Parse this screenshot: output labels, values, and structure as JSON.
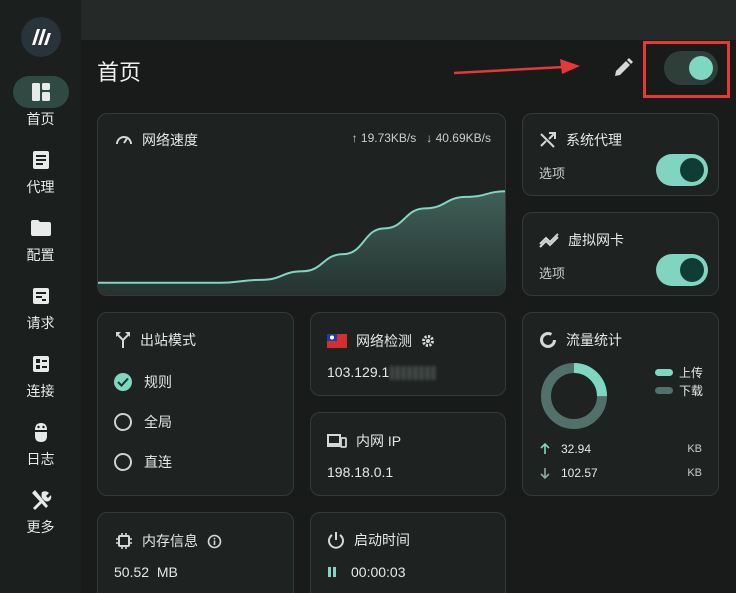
{
  "sidebar": {
    "items": [
      {
        "label": "首页",
        "icon": "dashboard-icon",
        "active": true
      },
      {
        "label": "代理",
        "icon": "document-icon"
      },
      {
        "label": "配置",
        "icon": "folder-icon"
      },
      {
        "label": "请求",
        "icon": "request-icon"
      },
      {
        "label": "连接",
        "icon": "connection-icon"
      },
      {
        "label": "日志",
        "icon": "bug-icon"
      },
      {
        "label": "更多",
        "icon": "tools-icon"
      }
    ]
  },
  "header": {
    "title": "首页"
  },
  "network_speed": {
    "title": "网络速度",
    "upload": "↑ 19.73KB/s",
    "download": "↓ 40.69KB/s",
    "chart_data": {
      "type": "area",
      "x": [
        0,
        1,
        2,
        3,
        4,
        5,
        6,
        7,
        8,
        9,
        10
      ],
      "values": [
        0.1,
        0.1,
        0.1,
        0.1,
        0.12,
        0.18,
        0.3,
        0.48,
        0.62,
        0.7,
        0.74
      ],
      "ylim": [
        0,
        1
      ],
      "grid": false
    }
  },
  "system_proxy": {
    "title": "系统代理",
    "option_label": "选项",
    "enabled": true
  },
  "virtual_nic": {
    "title": "虚拟网卡",
    "option_label": "选项",
    "enabled": true
  },
  "outbound_mode": {
    "title": "出站模式",
    "options": [
      {
        "label": "规则",
        "checked": true
      },
      {
        "label": "全局",
        "checked": false
      },
      {
        "label": "直连",
        "checked": false
      }
    ]
  },
  "network_check": {
    "title": "网络检测",
    "ip_prefix": "103.129.1"
  },
  "lan_ip": {
    "title": "内网 IP",
    "value": "198.18.0.1"
  },
  "traffic": {
    "title": "流量统计",
    "legend_upload": "上传",
    "legend_download": "下载",
    "upload_value": "32.94",
    "download_value": "102.57",
    "unit": "KB",
    "upload_fraction": 0.25
  },
  "memory": {
    "title": "内存信息",
    "value": "50.52  MB"
  },
  "uptime": {
    "title": "启动时间",
    "value": "00:00:03"
  },
  "colors": {
    "accent": "#7fd6c1",
    "annotation": "#e53935"
  }
}
